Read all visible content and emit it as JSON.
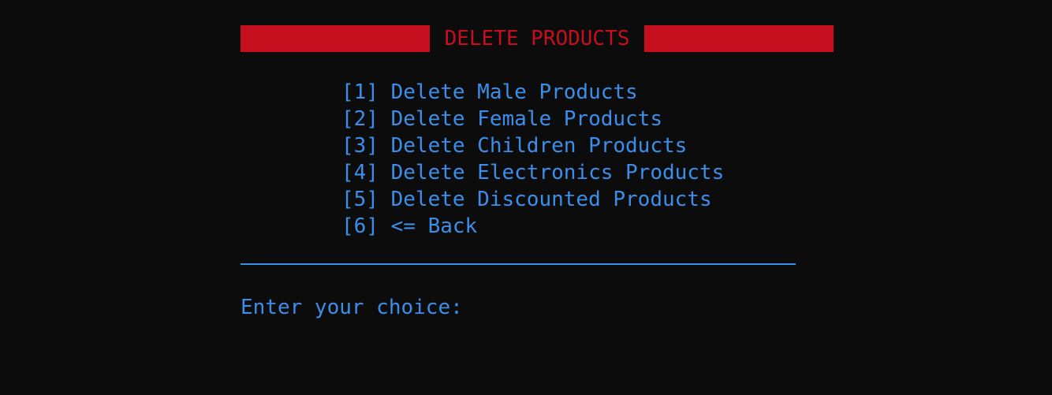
{
  "header": {
    "title": "DELETE PRODUCTS"
  },
  "menu": {
    "items": [
      {
        "label": "[1] Delete Male Products"
      },
      {
        "label": "[2] Delete Female Products"
      },
      {
        "label": "[3] Delete Children Products"
      },
      {
        "label": "[4] Delete Electronics Products"
      },
      {
        "label": "[5] Delete Discounted Products"
      },
      {
        "label": "[6] <= Back"
      }
    ]
  },
  "prompt": {
    "label": "Enter your choice: "
  },
  "colors": {
    "background": "#0c0c0c",
    "accent_red": "#c50f1f",
    "text_blue": "#3b8eea"
  }
}
